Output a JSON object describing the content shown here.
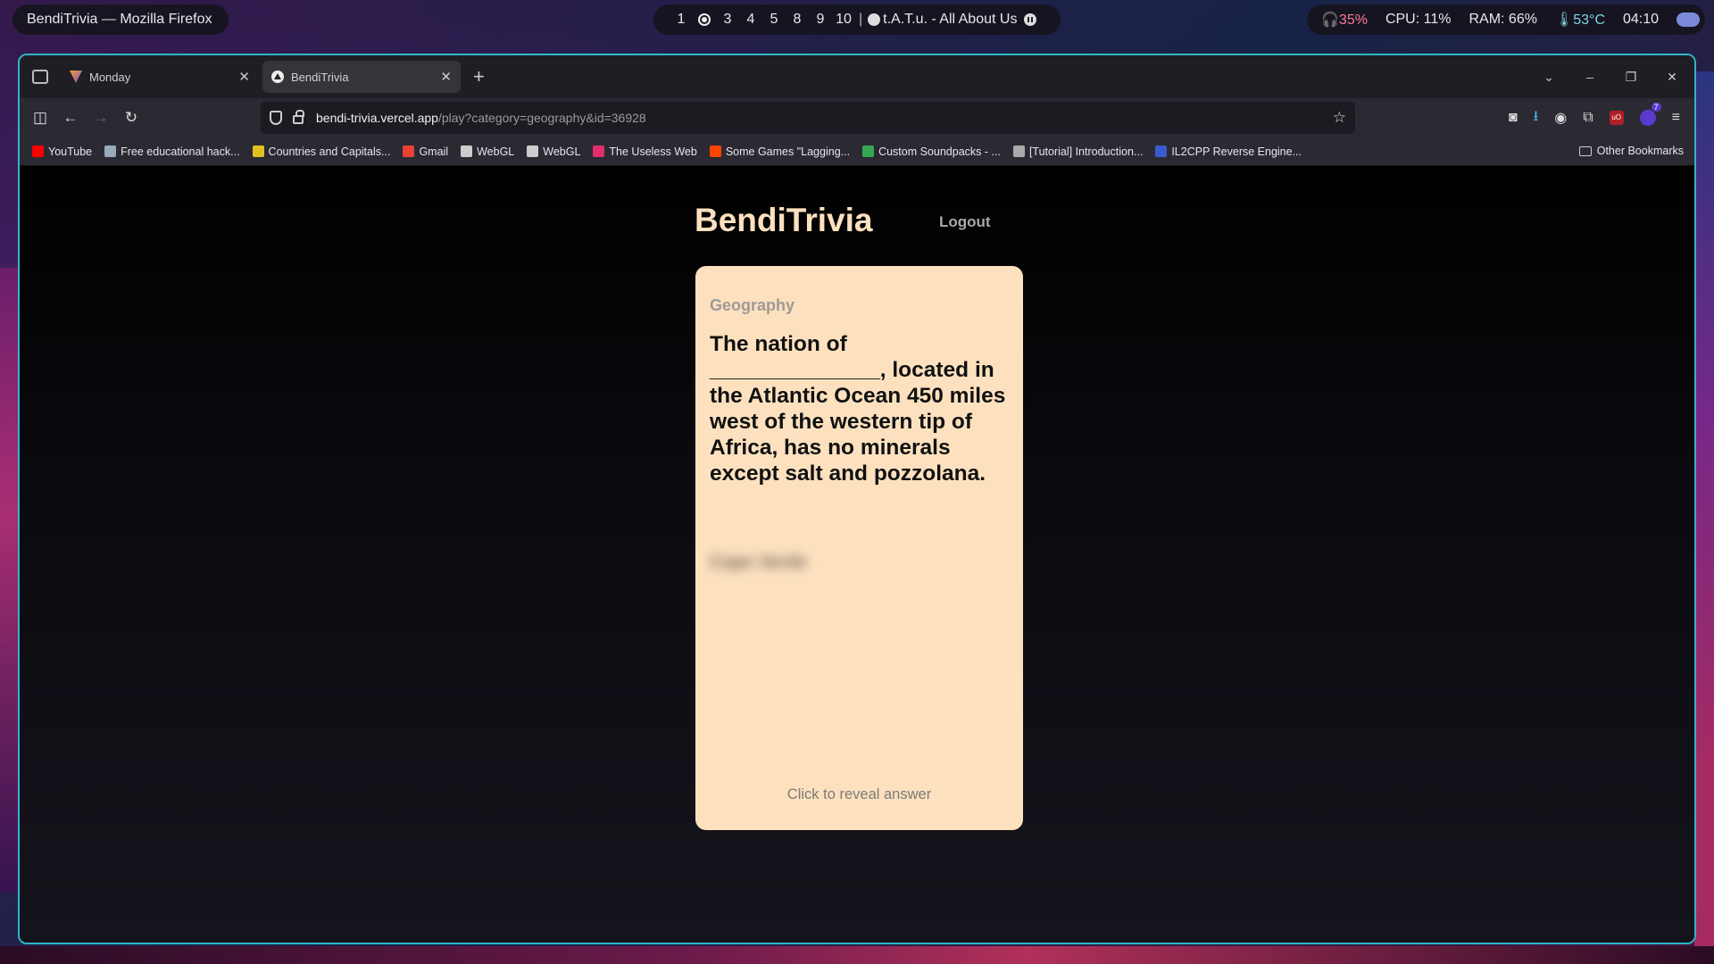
{
  "topbar": {
    "window_title": "BendiTrivia — Mozilla Firefox",
    "workspaces": [
      "1",
      "3",
      "4",
      "5",
      "8",
      "9",
      "10"
    ],
    "separator": "|",
    "now_playing": "t.A.T.u. - All About Us",
    "volume": "35%",
    "cpu": "CPU: 11%",
    "ram": "RAM: 66%",
    "temp": "53°C",
    "time": "04:10"
  },
  "tabs": [
    {
      "label": "Monday",
      "active": false
    },
    {
      "label": "BendiTrivia",
      "active": true
    }
  ],
  "url": {
    "host": "bendi-trivia.vercel.app",
    "path": "/play?category=geography&id=36928"
  },
  "bookmarks": [
    {
      "label": "YouTube",
      "color": "#ff0000"
    },
    {
      "label": "Free educational hack...",
      "color": "#9ab"
    },
    {
      "label": "Countries and Capitals...",
      "color": "#e0c020"
    },
    {
      "label": "Gmail",
      "color": "#ea4335"
    },
    {
      "label": "WebGL",
      "color": "#cccccc"
    },
    {
      "label": "WebGL",
      "color": "#cccccc"
    },
    {
      "label": "The Useless Web",
      "color": "#e0306a"
    },
    {
      "label": "Some Games \"Lagging...",
      "color": "#ff4500"
    },
    {
      "label": "Custom Soundpacks - ...",
      "color": "#34a853"
    },
    {
      "label": "[Tutorial] Introduction...",
      "color": "#aaaaaa"
    },
    {
      "label": "IL2CPP Reverse Engine...",
      "color": "#3a5ad0"
    }
  ],
  "other_bookmarks": "Other Bookmarks",
  "site": {
    "title": "BendiTrivia",
    "logout": "Logout"
  },
  "card": {
    "category": "Geography",
    "question": "The nation of ______________, located in the Atlantic Ocean 450 miles west of the western tip of Africa, has no minerals except salt and pozzolana.",
    "hidden_answer": "Cape Verde",
    "reveal_hint": "Click to reveal answer",
    "background": "#fde1bf"
  }
}
